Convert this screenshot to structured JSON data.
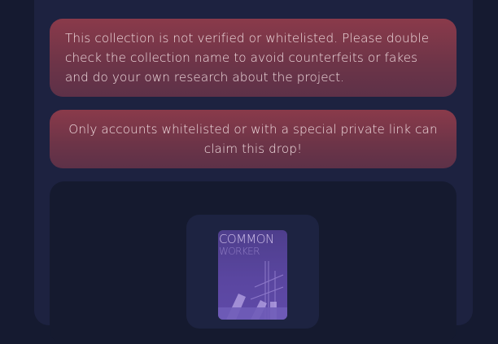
{
  "alerts": {
    "unverified_text": "This collection is not verified or whitelisted. Please double check the collection name to avoid counterfeits or fakes and do your own research about the project.",
    "whitelist_text": "Only accounts whitelisted or with a special private link can claim this drop!"
  },
  "nft": {
    "title_line1": "COMMON",
    "title_line2": "WORKER"
  },
  "colors": {
    "page_bg": "#151a30",
    "panel_bg": "#1d2240",
    "alert_bg": "#7a3648",
    "nft_bg": "#5a46a0"
  }
}
